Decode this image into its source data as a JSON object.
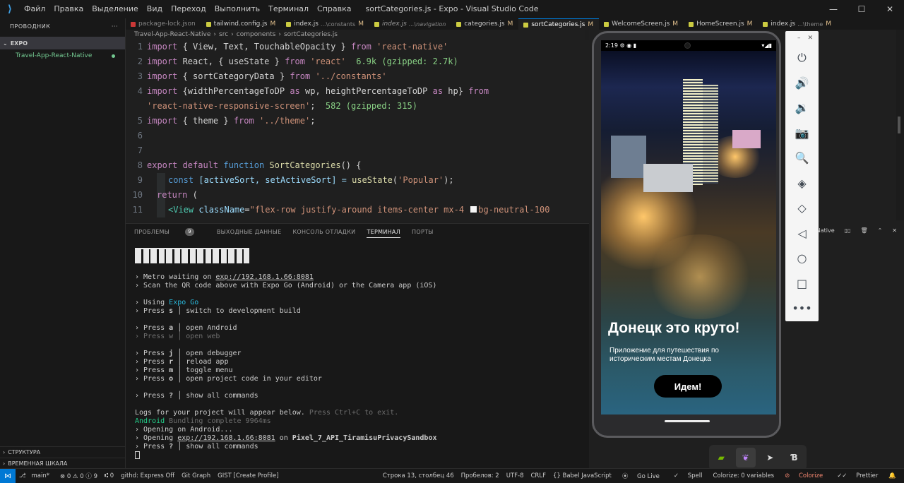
{
  "window": {
    "title": "sortCategories.js - Expo - Visual Studio Code",
    "menu": [
      "Файл",
      "Правка",
      "Выделение",
      "Вид",
      "Переход",
      "Выполнить",
      "Терминал",
      "Справка"
    ],
    "controls": {
      "minimize": "—",
      "maximize": "☐",
      "close": "✕"
    }
  },
  "sidebar": {
    "header": "ПРОВОДНИК",
    "more": "···",
    "section": "EXPO",
    "project": "Travel-App-React-Native",
    "bottom": [
      "СТРУКТУРА",
      "ВРЕМЕННАЯ ШКАЛА"
    ]
  },
  "tabs": [
    {
      "label": "package-lock.json",
      "dir": "",
      "mod": ""
    },
    {
      "label": "tailwind.config.js",
      "dir": "",
      "mod": "M"
    },
    {
      "label": "index.js",
      "dir": "...\\constants",
      "mod": "M"
    },
    {
      "label": "index.js",
      "dir": "...\\navigation",
      "mod": ""
    },
    {
      "label": "categories.js",
      "dir": "",
      "mod": "M"
    },
    {
      "label": "sortCategories.js",
      "dir": "",
      "mod": "M"
    },
    {
      "label": "WelcomeScreen.js",
      "dir": "",
      "mod": "M"
    },
    {
      "label": "HomeScreen.js",
      "dir": "",
      "mod": "M"
    },
    {
      "label": "index.js",
      "dir": "...\\theme",
      "mod": "M"
    }
  ],
  "breadcrumb": [
    "Travel-App-React-Native",
    "›",
    "src",
    "›",
    "components",
    "›",
    "sortCategories.js"
  ],
  "editor": {
    "line_numbers": [
      "1",
      "2",
      "3",
      "4",
      "",
      "5",
      "6",
      "7",
      "8",
      "9",
      "10",
      "11"
    ],
    "l1": {
      "a": "import",
      "b": " { View, Text, TouchableOpacity } ",
      "c": "from",
      "d": " 'react-native'"
    },
    "l2": {
      "a": "import",
      "b": " React, { useState } ",
      "c": "from",
      "d": " 'react'",
      "e": "  6.9k (gzipped: 2.7k)"
    },
    "l3": {
      "a": "import",
      "b": " { sortCategoryData } ",
      "c": "from",
      "d": " '../constants'"
    },
    "l4": {
      "a": "import",
      "b": " {widthPercentageToDP ",
      "c": "as",
      "d": " wp, heightPercentageToDP ",
      "e": "as",
      "f": " hp} ",
      "g": "from"
    },
    "l4b": {
      "a": "'react-native-responsive-screen'",
      "b": ";",
      "c": "  582 (gzipped: 315)"
    },
    "l5": {
      "a": "import",
      "b": " { theme } ",
      "c": "from",
      "d": " '../theme'",
      "e": ";"
    },
    "l8": {
      "a": "export",
      "b": " default",
      "c": " function",
      "d": " SortCategories",
      "e": "() {"
    },
    "l9": {
      "a": "const",
      "b": " [activeSort, setActiveSort] = ",
      "c": "useState",
      "d": "(",
      "e": "'Popular'",
      "f": ");"
    },
    "l10": {
      "a": "return",
      "b": " ("
    },
    "l11": {
      "a": "<View",
      "b": " className",
      "c": "=",
      "d": "\"flex-row justify-around items-center mx-4 ",
      "e": "bg-neutral-100"
    }
  },
  "panel": {
    "tabs": [
      "ПРОБЛЕМЫ",
      "ВЫХОДНЫЕ ДАННЫЕ",
      "КОНСОЛЬ ОТЛАДКИ",
      "ТЕРМИНАЛ",
      "ПОРТЫ"
    ],
    "problems_count": "9",
    "terminal": {
      "l1a": "› Metro waiting on ",
      "l1b": "exp://192.168.1.66:8081",
      "l2": "› Scan the QR code above with Expo Go (Android) or the Camera app (iOS)",
      "l3a": "› Using ",
      "l3b": "Expo Go",
      "l4a": "› Press ",
      "l4b": "s",
      "l4c": " │ switch to development build",
      "l5a": "› Press ",
      "l5b": "a",
      "l5c": " │ open Android",
      "l6": "› Press w │ open web",
      "l7a": "› Press ",
      "l7b": "j",
      "l7c": " │ open debugger",
      "l8a": "› Press ",
      "l8b": "r",
      "l8c": " │ reload app",
      "l9a": "› Press ",
      "l9b": "m",
      "l9c": " │ toggle menu",
      "l10a": "› Press ",
      "l10b": "o",
      "l10c": " │ open project code in your editor",
      "l11a": "› Press ",
      "l11b": "?",
      "l11c": " │ show all commands",
      "l12a": "Logs for your project will appear below. ",
      "l12b": "Press Ctrl+C to exit.",
      "l13a": "Android",
      "l13b": " Bundling complete 9964ms",
      "l14": "› Opening on Android...",
      "l15a": "› Opening ",
      "l15b": "exp://192.168.1.66:8081",
      "l15c": " on ",
      "l15d": "Pixel_7_API_TiramisuPrivacySandbox",
      "l16a": "› Press ",
      "l16b": "?",
      "l16c": " │ show all commands"
    },
    "right_label": "Native"
  },
  "phone": {
    "time": "2:19",
    "status_icons": "⚙ ◉ ▮",
    "signal": "▾◢▮",
    "heading": "Донецк это круто!",
    "subtitle": "Приложение для путешествия по историческим местам Донецка",
    "button": "Идем!"
  },
  "emulator": {
    "close": "✕",
    "minimize": "–",
    "icons": [
      "power-icon",
      "volume-up-icon",
      "volume-down-icon",
      "camera-icon",
      "zoom-icon",
      "rotate-left-icon",
      "rotate-right-icon",
      "back-icon",
      "home-icon",
      "overview-icon",
      "more-icon"
    ]
  },
  "statusbar": {
    "branch": "main*",
    "errors": "⊗ 0 ⚠ 0 ⓘ 9",
    "ports": "⑆ 0",
    "githd": "githd: Express Off",
    "gitgraph": "Git Graph",
    "gist": "GIST [Create Profile]",
    "position": "Строка 13, столбец 46",
    "spaces": "Пробелов: 2",
    "encoding": "UTF-8",
    "eol": "CRLF",
    "language": "{} Babel JavaScript",
    "golive": "Go Live",
    "spell": "Spell",
    "colorize": "Colorize: 0 variables",
    "colorize2": "Colorize",
    "prettier": "Prettier"
  }
}
